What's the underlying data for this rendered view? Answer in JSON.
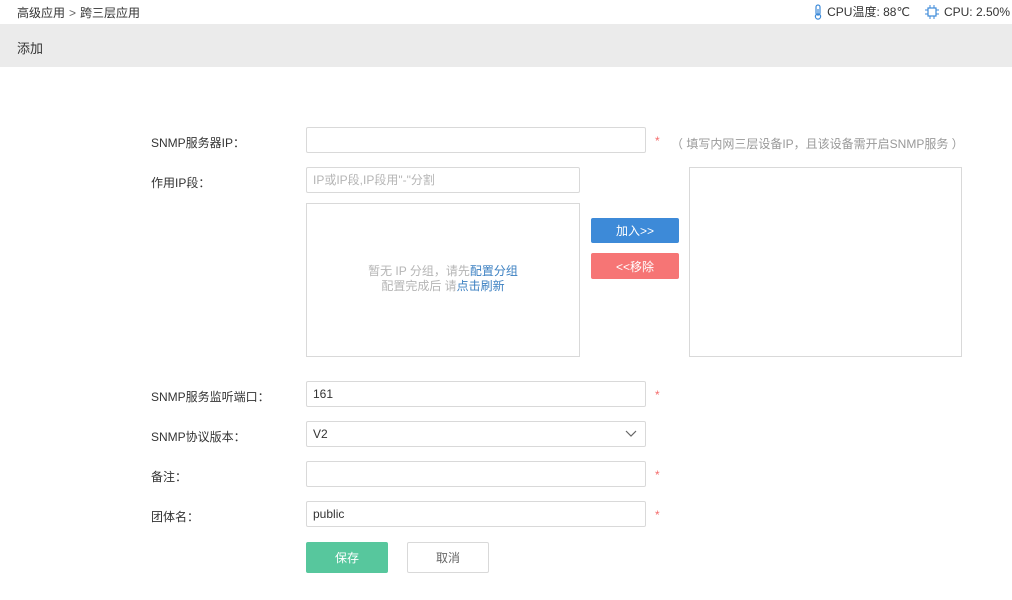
{
  "breadcrumb": {
    "parent": "高级应用",
    "separator": ">",
    "current": "跨三层应用"
  },
  "status": {
    "cpu_temp": "CPU温度: 88℃",
    "cpu_usage": "CPU: 2.50%"
  },
  "page": {
    "title": "添加"
  },
  "form": {
    "snmp_ip": {
      "label": "SNMP服务器IP：",
      "value": "",
      "required": "*",
      "hint": "（ 填写内网三层设备IP，且该设备需开启SNMP服务 ）"
    },
    "ip_range": {
      "label": "作用IP段：",
      "placeholder": "IP或IP段,IP段用\"-\"分割",
      "empty_line1_prefix": "暂无 IP 分组，请先",
      "empty_line1_link": "配置分组",
      "empty_line2_prefix": "配置完成后 请",
      "empty_line2_link": "点击刷新",
      "add_button": "加入>>",
      "remove_button": "<<移除"
    },
    "snmp_port": {
      "label": "SNMP服务监听端口：",
      "value": "161",
      "required": "*"
    },
    "snmp_version": {
      "label": "SNMP协议版本：",
      "value": "V2"
    },
    "remark": {
      "label": "备注：",
      "value": "",
      "required": "*"
    },
    "community": {
      "label": "团体名：",
      "value": "public",
      "required": "*"
    }
  },
  "actions": {
    "save": "保存",
    "cancel": "取消"
  },
  "colors": {
    "primary_blue": "#3d8ad8",
    "danger_red": "#f67575",
    "save_green": "#57c79d",
    "required_red": "#f56c6c",
    "link_blue": "#3a7fc1"
  },
  "icons": {
    "temperature": "thermometer-icon",
    "cpu": "cpu-chip-icon",
    "dropdown": "chevron-down-icon"
  }
}
